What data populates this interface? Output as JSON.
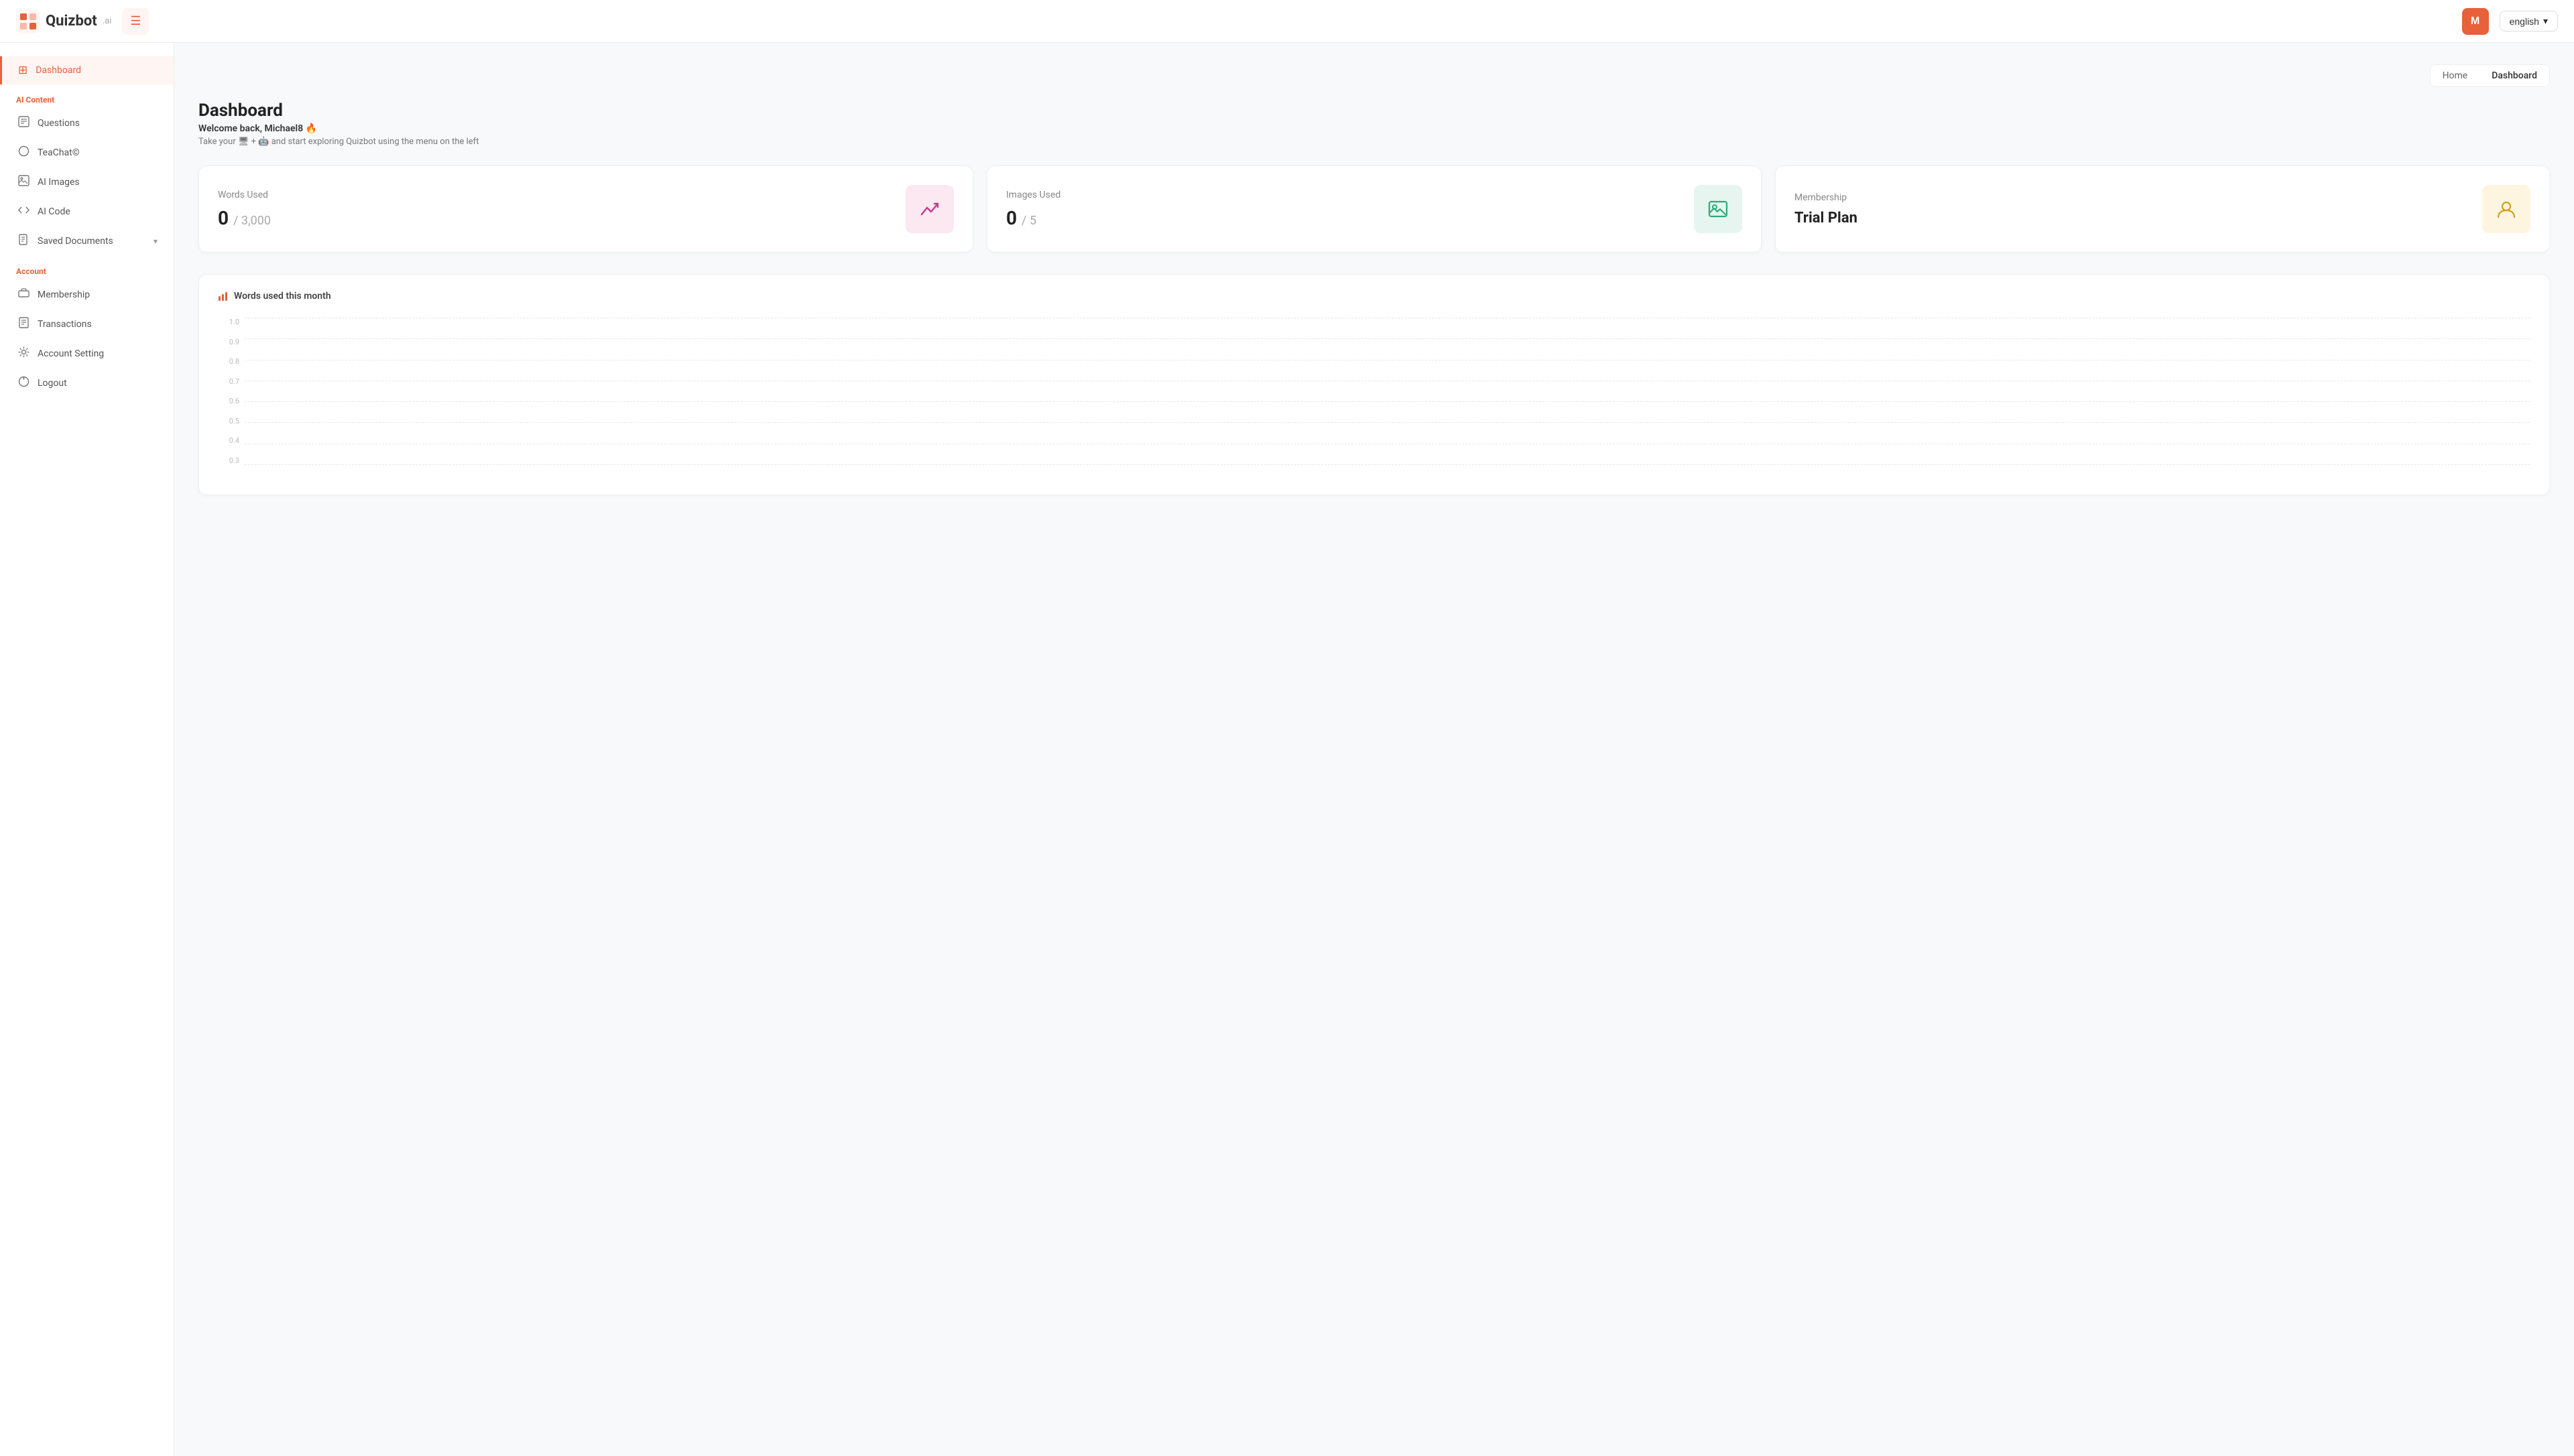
{
  "header": {
    "logo_text": "Quizbot",
    "logo_suffix": ".ai",
    "avatar_initial": "M",
    "language_label": "english",
    "language_arrow": "▾"
  },
  "sidebar": {
    "ai_content_label": "AI Content",
    "account_label": "Account",
    "items": [
      {
        "id": "dashboard",
        "label": "Dashboard",
        "icon": "⊞",
        "active": true
      },
      {
        "id": "questions",
        "label": "Questions",
        "icon": "≡"
      },
      {
        "id": "teachat",
        "label": "TeaChat©",
        "icon": "○"
      },
      {
        "id": "ai-images",
        "label": "AI Images",
        "icon": "▣"
      },
      {
        "id": "ai-code",
        "label": "AI Code",
        "icon": "⟨⟩"
      },
      {
        "id": "saved-documents",
        "label": "Saved Documents",
        "icon": "📄",
        "badge": "▾"
      },
      {
        "id": "membership",
        "label": "Membership",
        "icon": "🎁"
      },
      {
        "id": "transactions",
        "label": "Transactions",
        "icon": "📋"
      },
      {
        "id": "account-setting",
        "label": "Account Setting",
        "icon": "⚙"
      },
      {
        "id": "logout",
        "label": "Logout",
        "icon": "⏻"
      }
    ]
  },
  "breadcrumb": {
    "home_label": "Home",
    "current_label": "Dashboard"
  },
  "page": {
    "title": "Dashboard",
    "subtitle": "Welcome back, Michael8",
    "description": "Take your 🖥 + 🤖 and start exploring Quizbot using the menu on the left"
  },
  "stats": [
    {
      "label": "Words Used",
      "value": "0",
      "denom": "/ 3,000",
      "icon_type": "trend",
      "icon_box_class": "icon-box-pink"
    },
    {
      "label": "Images Used",
      "value": "0",
      "denom": "/ 5",
      "icon_type": "image",
      "icon_box_class": "icon-box-green"
    },
    {
      "label": "Membership",
      "value": "Trial Plan",
      "denom": "",
      "icon_type": "person",
      "icon_box_class": "icon-box-yellow"
    }
  ],
  "chart": {
    "title": "Words used this month",
    "y_labels": [
      "1.0",
      "0.9",
      "0.8",
      "0.7",
      "0.6",
      "0.5",
      "0.4",
      "0.3"
    ]
  }
}
